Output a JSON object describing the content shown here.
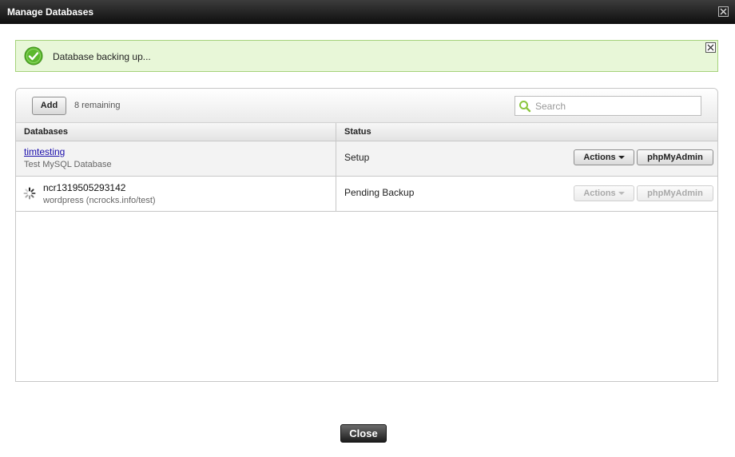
{
  "dialog": {
    "title": "Manage Databases",
    "close_label": "Close"
  },
  "notice": {
    "message": "Database backing up..."
  },
  "toolbar": {
    "add_label": "Add",
    "remaining": "8 remaining",
    "search_placeholder": "Search"
  },
  "table": {
    "columns": [
      "Databases",
      "Status"
    ],
    "rows": [
      {
        "name": "timtesting",
        "description": "Test MySQL Database",
        "status": "Setup",
        "actions_label": "Actions",
        "phpmyadmin_label": "phpMyAdmin",
        "enabled": true
      },
      {
        "name": "ncr1319505293142",
        "description": "wordpress (ncrocks.info/test)",
        "status": "Pending Backup",
        "actions_label": "Actions",
        "phpmyadmin_label": "phpMyAdmin",
        "enabled": false
      }
    ]
  },
  "colors": {
    "titlebar": "#0e0e0e",
    "notice_bg": "#e8f7d8",
    "notice_border": "#a5d27a",
    "success_icon": "#5cb82e",
    "link": "#1a0dab"
  },
  "icons": {
    "notice": "check-circle-icon",
    "search": "search-icon",
    "loading": "spinner-icon"
  }
}
